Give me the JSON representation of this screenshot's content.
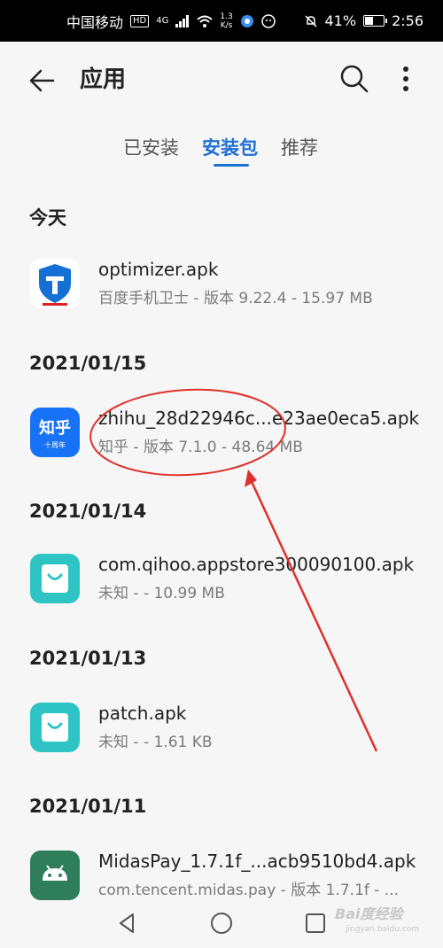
{
  "status_bar": {
    "carrier": "中国移动",
    "hd": "HD",
    "network": "4G",
    "speed_value": "1.3",
    "speed_unit": "K/s",
    "battery": "41%",
    "time": "2:56"
  },
  "app_bar": {
    "title": "应用"
  },
  "tabs": [
    {
      "label": "已安装"
    },
    {
      "label": "安装包"
    },
    {
      "label": "推荐"
    }
  ],
  "active_tab": "安装包",
  "sections": [
    {
      "header": "今天",
      "items": [
        {
          "name": "optimizer.apk",
          "meta": "百度手机卫士 - 版本 9.22.4 - 15.97 MB",
          "icon": "shield-icon"
        }
      ]
    },
    {
      "header": "2021/01/15",
      "items": [
        {
          "name": "zhihu_28d22946c...e23ae0eca5.apk",
          "meta": "知乎 - 版本 7.1.0 - 48.64 MB",
          "icon": "zhihu-icon",
          "icon_text": "知乎",
          "icon_subtext": "十周年"
        }
      ]
    },
    {
      "header": "2021/01/14",
      "items": [
        {
          "name": "com.qihoo.appstore300090100.apk",
          "meta": "未知 - - 10.99 MB",
          "icon": "appstore-bag-icon"
        }
      ]
    },
    {
      "header": "2021/01/13",
      "items": [
        {
          "name": "patch.apk",
          "meta": "未知 - - 1.61 KB",
          "icon": "appstore-bag-icon"
        }
      ]
    },
    {
      "header": "2021/01/11",
      "items": [
        {
          "name": "MidasPay_1.7.1f_...acb9510bd4.apk",
          "meta": "com.tencent.midas.pay - 版本 1.7.1f - ...",
          "icon": "android-icon"
        }
      ]
    }
  ],
  "watermark": {
    "text": "Bai度经验",
    "sub": "jingyan.baidu.com"
  },
  "colors": {
    "accent": "#1e6fd6",
    "annotation": "#e0302a",
    "appstore_teal": "#2fc4c4",
    "android_green": "#2e7d5b",
    "zhihu_blue": "#1772f6"
  }
}
